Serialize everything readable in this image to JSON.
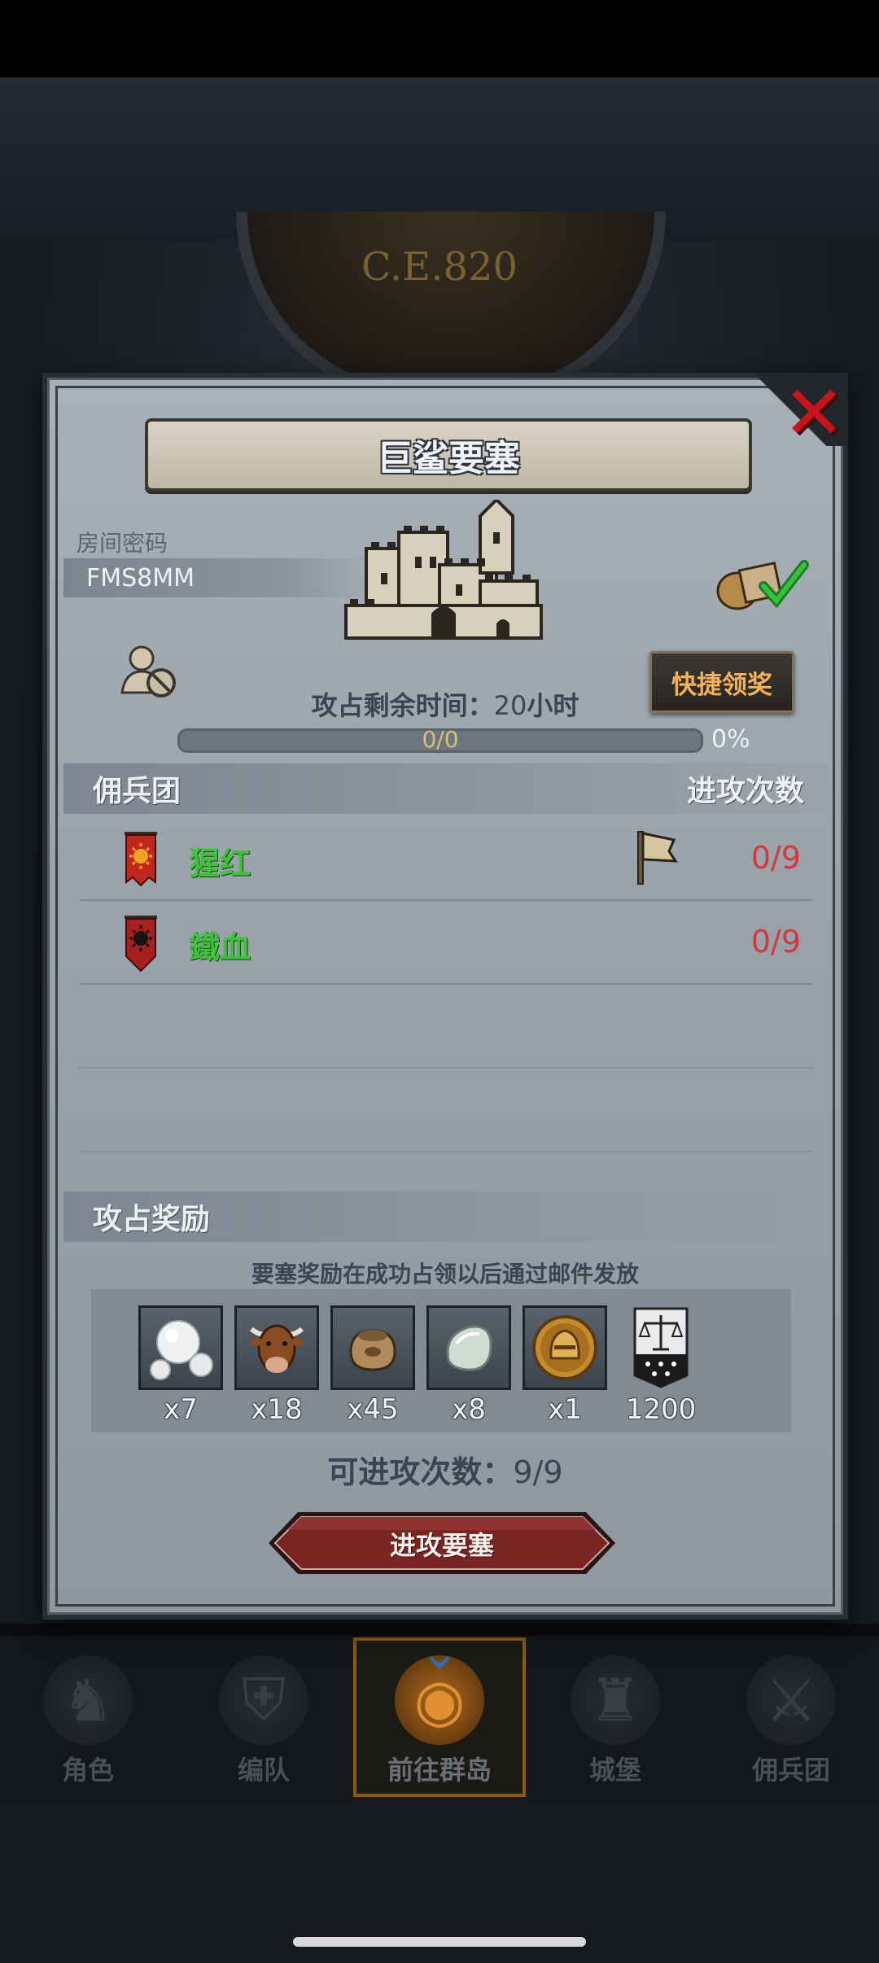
{
  "background": {
    "era_label": "C.E.820"
  },
  "modal": {
    "title": "巨鲨要塞",
    "room_label": "房间密码",
    "room_code": "FMS8MM",
    "quick_claim_label": "快捷领奖",
    "time_label": "攻占剩余时间：",
    "time_value": "20",
    "time_unit": "小时",
    "progress_text": "0/0",
    "progress_percent_text": "0%",
    "progress_fraction": 0,
    "mercenary_header": "佣兵团",
    "attack_count_header": "进攻次数",
    "mercenaries": [
      {
        "name": "猩红",
        "count": "0/9",
        "banner_icon": "sun-banner-icon",
        "banner_color": "#c1271d",
        "has_flag": true
      },
      {
        "name": "鐵血",
        "count": "0/9",
        "banner_icon": "black-sun-banner-icon",
        "banner_color": "#a81f1f",
        "has_flag": false
      }
    ],
    "reward_header": "攻占奖励",
    "reward_note": "要塞奖励在成功占领以后通过邮件发放",
    "rewards": [
      {
        "icon": "pearl-icon",
        "qty": "x7"
      },
      {
        "icon": "bull-icon",
        "qty": "x18"
      },
      {
        "icon": "sack-icon",
        "qty": "x45"
      },
      {
        "icon": "stone-icon",
        "qty": "x8"
      },
      {
        "icon": "helmet-coin-icon",
        "qty": "x1"
      },
      {
        "icon": "justice-banner-icon",
        "qty": "1200"
      }
    ],
    "attempts_label": "可进攻次数：",
    "attempts_value": "9/9",
    "attack_button_label": "进攻要塞"
  },
  "bottom_nav": [
    {
      "label": "角色",
      "icon": "knight-icon",
      "active": false
    },
    {
      "label": "编队",
      "icon": "helmet-icon",
      "active": false
    },
    {
      "label": "前往群岛",
      "icon": "islands-icon",
      "active": true
    },
    {
      "label": "城堡",
      "icon": "castle-icon",
      "active": false
    },
    {
      "label": "佣兵团",
      "icon": "mercenary-icon",
      "active": false
    }
  ],
  "colors": {
    "accent_gold": "#f2b15a",
    "name_green": "#3ec23a",
    "count_red": "#d23a3a",
    "close_red": "#c8151b",
    "attack_button": "#7a2424"
  }
}
